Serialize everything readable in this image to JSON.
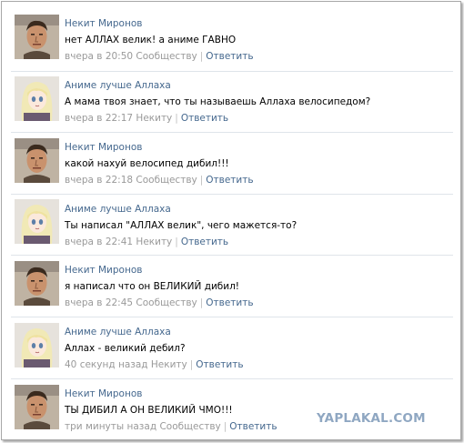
{
  "comments": [
    {
      "author": "Некит Миронов",
      "avatar": "man-photo-avatar",
      "text": "нет АЛЛАХ велик! а аниме ГАВНО",
      "time": "вчера в 20:50",
      "to": "Сообществу",
      "reply": "Ответить"
    },
    {
      "author": "Аниме лучше Аллаха",
      "avatar": "anime-girl-avatar",
      "text": "А мама твоя знает, что ты называешь Аллаха велосипедом?",
      "time": "вчера в 22:17",
      "to": "Некиту",
      "reply": "Ответить"
    },
    {
      "author": "Некит Миронов",
      "avatar": "man-photo-avatar",
      "text": "какой нахуй велосипед дибил!!!",
      "time": "вчера в 22:18",
      "to": "Сообществу",
      "reply": "Ответить"
    },
    {
      "author": "Аниме лучше Аллаха",
      "avatar": "anime-girl-avatar",
      "text": "Ты написал \"АЛЛАХ велик\", чего мажется-то?",
      "time": "вчера в 22:41",
      "to": "Некиту",
      "reply": "Ответить"
    },
    {
      "author": "Некит Миронов",
      "avatar": "man-photo-avatar",
      "text": "я написал что он ВЕЛИКИЙ дибил!",
      "time": "вчера в 22:45",
      "to": "Сообществу",
      "reply": "Ответить"
    },
    {
      "author": "Аниме лучше Аллаха",
      "avatar": "anime-girl-avatar",
      "text": "Аллах - великий дебил?",
      "time": "40 секунд назад",
      "to": "Некиту",
      "reply": "Ответить"
    },
    {
      "author": "Некит Миронов",
      "avatar": "man-photo-avatar",
      "text": "ТЫ ДИБИЛ А ОН ВЕЛИКИЙ ЧМО!!!",
      "time": "три минуты назад",
      "to": "Сообществу",
      "reply": "Ответить"
    }
  ],
  "watermark": "YAPLAKAL.COM",
  "colors": {
    "link": "#45688e",
    "meta": "#999999",
    "divider": "#dfe4ea",
    "watermark": "#8fa7c2"
  }
}
